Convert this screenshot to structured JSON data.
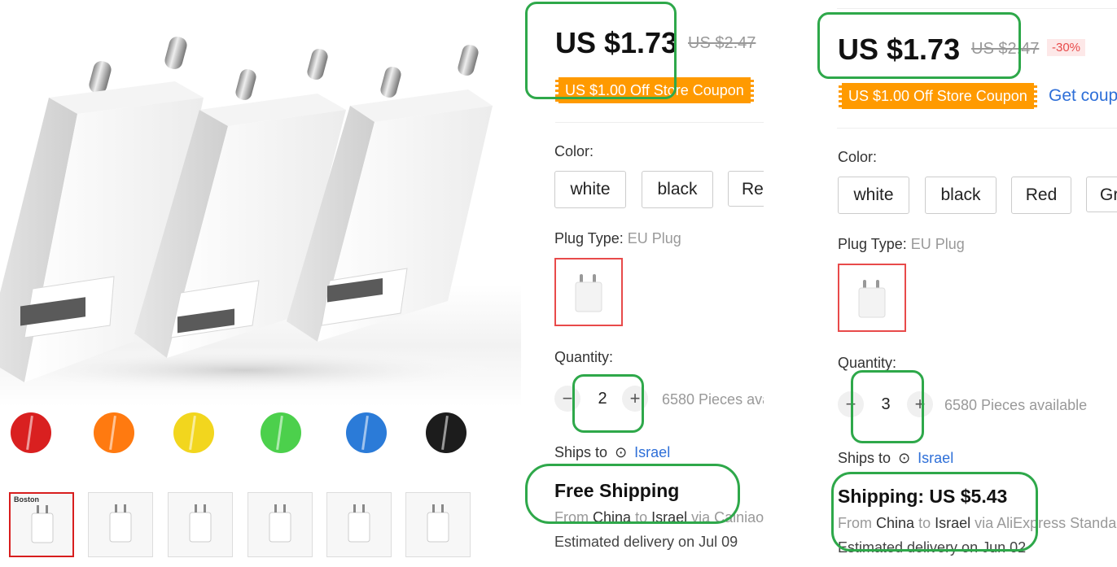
{
  "swatch_colors": [
    "#d92020",
    "#ff7a10",
    "#f2d61e",
    "#4cd04c",
    "#2b7bd8",
    "#1c1c1c"
  ],
  "thumbnails": [
    {
      "name": "thumb-boston",
      "icon": "charger-trio",
      "selected": true,
      "text": "Boston"
    },
    {
      "name": "thumb-phone-charging",
      "icon": "charger-phone",
      "selected": false,
      "text": ""
    },
    {
      "name": "thumb-spec-sheet",
      "icon": "charger-spec",
      "selected": false,
      "text": ""
    },
    {
      "name": "thumb-broadband",
      "icon": "charger-globe",
      "selected": false,
      "text": ""
    },
    {
      "name": "thumb-safety",
      "icon": "charger-hand",
      "selected": false,
      "text": ""
    },
    {
      "name": "thumb-compat",
      "icon": "charger-devices",
      "selected": false,
      "text": ""
    }
  ],
  "left_panel": {
    "price": "US $1.73",
    "old_price": "US $2.47",
    "coupon": "US $1.00 Off Store Coupon",
    "color_label": "Color:",
    "colors": [
      "white",
      "black",
      "Re"
    ],
    "plug_label": "Plug Type:",
    "plug_value": "EU Plug",
    "quantity_label": "Quantity:",
    "quantity": "2",
    "minus": "−",
    "plus": "+",
    "available": "6580 Pieces ava",
    "ships_label": "Ships to",
    "ships_country": "Israel",
    "shipping": "Free Shipping",
    "from_prefix": "From",
    "from_country": "China",
    "to_word": "to",
    "to_country": "Israel",
    "via": "via Cainiao",
    "delivery": "Estimated delivery on Jul 09"
  },
  "right_panel": {
    "price": "US $1.73",
    "old_price": "US $2.47",
    "discount": "-30%",
    "coupon": "US $1.00 Off Store Coupon",
    "get_coupon": "Get coupons",
    "color_label": "Color:",
    "colors": [
      "white",
      "black",
      "Red",
      "Gr"
    ],
    "plug_label": "Plug Type:",
    "plug_value": "EU Plug",
    "quantity_label": "Quantity:",
    "quantity": "3",
    "minus": "−",
    "plus": "+",
    "available": "6580 Pieces available",
    "ships_label": "Ships to",
    "ships_country": "Israel",
    "shipping": "Shipping: US $5.43",
    "from_prefix": "From",
    "from_country": "China",
    "to_word": "to",
    "to_country": "Israel",
    "via": "via AliExpress Standard",
    "delivery": "Estimated delivery on Jun 02"
  },
  "accent_colors": {
    "highlight": "#2ea84a",
    "coupon": "#ff9a00",
    "link": "#2e6fd8",
    "selected": "#e84a4a"
  }
}
